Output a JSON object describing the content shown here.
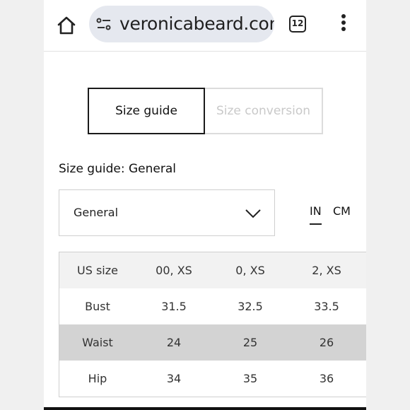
{
  "browser": {
    "url": "veronicabeard.com",
    "tab_count": "12",
    "icons": [
      "home-icon",
      "site-settings-icon",
      "tabs-icon",
      "more-vert-icon"
    ]
  },
  "tabs": {
    "size_guide": "Size guide",
    "size_conversion": "Size conversion"
  },
  "section": {
    "title": "Size guide: General"
  },
  "dropdown": {
    "selected": "General"
  },
  "units": {
    "in": "IN",
    "cm": "CM",
    "active": "IN"
  },
  "table": {
    "header": [
      "US size",
      "00, XS",
      "0, XS",
      "2, XS"
    ],
    "rows": [
      [
        "Bust",
        "31.5",
        "32.5",
        "33.5"
      ],
      [
        "Waist",
        "24",
        "25",
        "26"
      ],
      [
        "Hip",
        "34",
        "35",
        "36"
      ]
    ]
  },
  "colors": {
    "header_row": "#f2f2f2",
    "shaded_row": "#d3d3d3",
    "url_pill": "#e5e8ef",
    "inactive_text": "#c9c9c9"
  }
}
